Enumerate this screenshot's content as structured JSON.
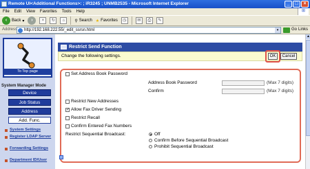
{
  "window": {
    "title": "Remote UI<Additional Functions>: ; iR3245 ; UNMB2535 - Microsoft Internet Explorer",
    "buttons": {
      "minimize": "_",
      "maximize": "□",
      "close": "×"
    }
  },
  "menubar": {
    "items": [
      "File",
      "Edit",
      "View",
      "Favorites",
      "Tools",
      "Help"
    ]
  },
  "toolbar": {
    "back": "Back",
    "search": "Search",
    "favorites": "Favorites"
  },
  "addressbar": {
    "label": "Address",
    "url": "http://192.168.222.55/_edit_ssrsn.html",
    "go": "Go",
    "links": "Links"
  },
  "sidebar": {
    "top_page": "To Top page",
    "mode_title": "System Manager Mode",
    "buttons": [
      "Device",
      "Job Status",
      "Address",
      "Add. Func."
    ],
    "active_button": "Add. Func.",
    "links": [
      "System Settings",
      "Register LDAP Server",
      "Forwarding Settings",
      "Department ID/User"
    ]
  },
  "main": {
    "header_title": "Restrict Send Function",
    "instruction": "Change the following settings.",
    "ok_label": "OK",
    "cancel_label": "Cancel",
    "settings": {
      "set_address_book_password": {
        "label": "Set Address Book Password",
        "checked": false
      },
      "address_book_password_label": "Address Book Password",
      "confirm_label": "Confirm",
      "max_hint_1": "(Max 7 digits)",
      "max_hint_2": "(Max 7 digits)",
      "restrict_new_addresses": {
        "label": "Restrict New Addresses",
        "checked": false
      },
      "allow_fax_driver_sending": {
        "label": "Allow Fax Driver Sending",
        "checked": true
      },
      "restrict_recall": {
        "label": "Restrict Recall",
        "checked": false
      },
      "confirm_entered_fax_numbers": {
        "label": "Confirm Entered Fax Numbers",
        "checked": false
      },
      "restrict_sequential_broadcast_label": "Restrict Sequential Broadcast:",
      "broadcast_options": [
        "Off",
        "Confirm Before Sequential Broadcast",
        "Prohibit Sequential Broadcast"
      ],
      "broadcast_selected": "Off"
    }
  }
}
